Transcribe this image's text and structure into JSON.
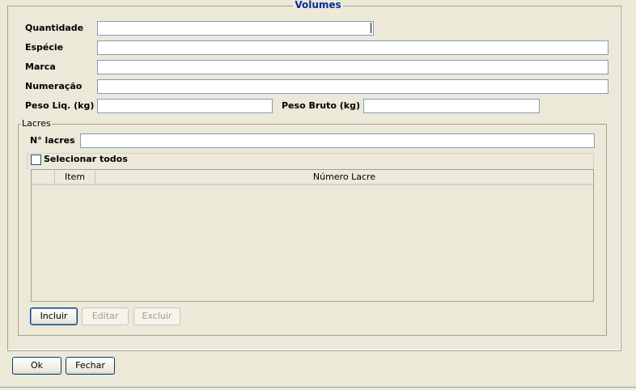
{
  "window": {
    "title": "Volumes"
  },
  "form": {
    "quantidade_label": "Quantidade",
    "quantidade_value": "",
    "especie_label": "Espécie",
    "especie_value": "",
    "marca_label": "Marca",
    "marca_value": "",
    "numeracao_label": "Numeração",
    "numeracao_value": "",
    "peso_liq_label": "Peso Liq. (kg)",
    "peso_liq_value": "",
    "peso_bruto_label": "Peso Bruto (kg)",
    "peso_bruto_value": ""
  },
  "lacres": {
    "group_label": "Lacres",
    "n_lacres_label": "N° lacres",
    "n_lacres_value": "",
    "select_all_label": "Selecionar todos",
    "select_all_checked": false,
    "table": {
      "columns": [
        "",
        "Item",
        "Número Lacre"
      ],
      "rows": []
    },
    "buttons": {
      "incluir": "Incluir",
      "editar": "Editar",
      "excluir": "Excluir"
    }
  },
  "footer": {
    "ok": "Ok",
    "fechar": "Fechar"
  }
}
